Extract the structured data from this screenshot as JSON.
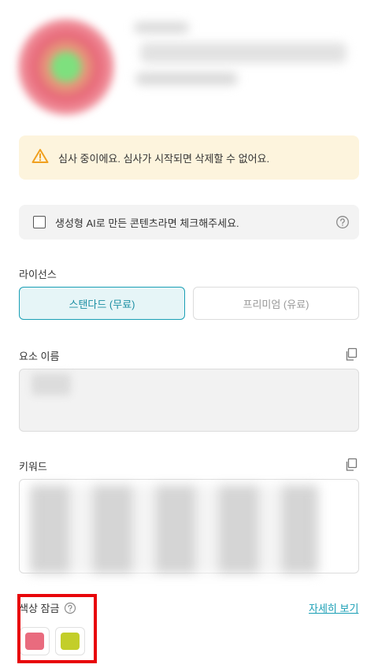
{
  "preview": {
    "thumbnail_icon": "blurred-thumbnail"
  },
  "review_notice": {
    "icon": "warning-triangle-icon",
    "text": "심사 중이에요. 심사가 시작되면 삭제할 수 없어요."
  },
  "ai_check": {
    "label": "생성형 AI로 만든 콘텐츠라면 체크해주세요.",
    "checked": false
  },
  "license": {
    "label": "라이선스",
    "standard": "스탠다드 (무료)",
    "premium": "프리미엄 (유료)",
    "selected": "standard"
  },
  "element_name": {
    "label": "요소 이름",
    "value": ""
  },
  "keywords": {
    "label": "키워드",
    "value": ""
  },
  "color_lock": {
    "label": "색상 잠금",
    "details_link": "자세히 보기",
    "swatches": [
      {
        "color": "#e96b7e"
      },
      {
        "color": "#c3ce2a"
      }
    ]
  },
  "colors": {
    "accent": "#1a9fb5",
    "warning_bg": "#fdf4dd",
    "highlight": "#e8060a"
  }
}
